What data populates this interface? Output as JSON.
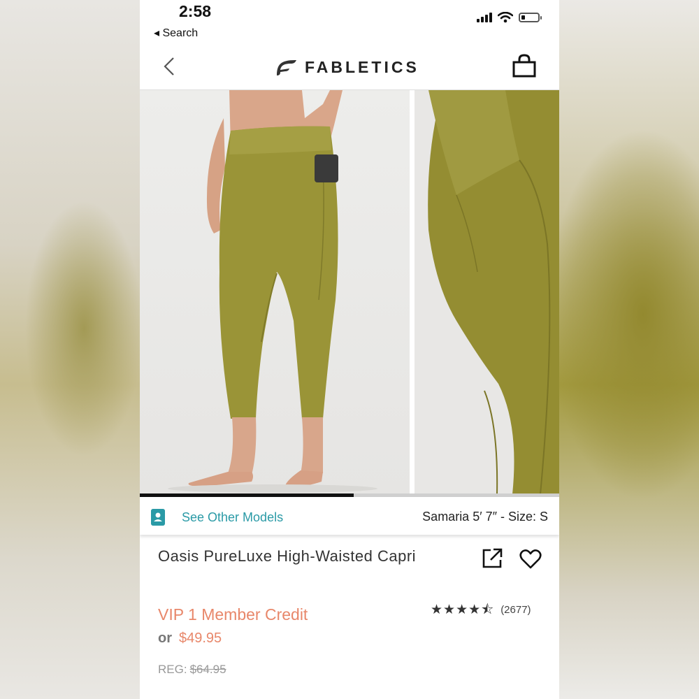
{
  "status_bar": {
    "time": "2:58",
    "back_label": "◂ Search"
  },
  "header": {
    "brand": "FABLETICS"
  },
  "gallery": {
    "progress_fraction": 0.51
  },
  "model": {
    "link_label": "See Other Models",
    "info": "Samaria 5′ 7″ - Size: S"
  },
  "product": {
    "title": "Oasis PureLuxe High-Waisted Capri",
    "vip_label": "VIP 1 Member Credit",
    "or_label": "or",
    "price": "$49.95",
    "reg_label": "REG:",
    "reg_price": "$64.95",
    "rating_value": 4.5,
    "rating_count": "(2677)"
  },
  "colors": {
    "accent_teal": "#2a9aa6",
    "price_coral": "#e8876a",
    "legging_olive": "#9a9437"
  },
  "icons": [
    "back-chevron-icon",
    "fabletics-logo-icon",
    "shopping-bag-icon",
    "model-profile-icon",
    "share-icon",
    "heart-icon",
    "star-icon"
  ]
}
